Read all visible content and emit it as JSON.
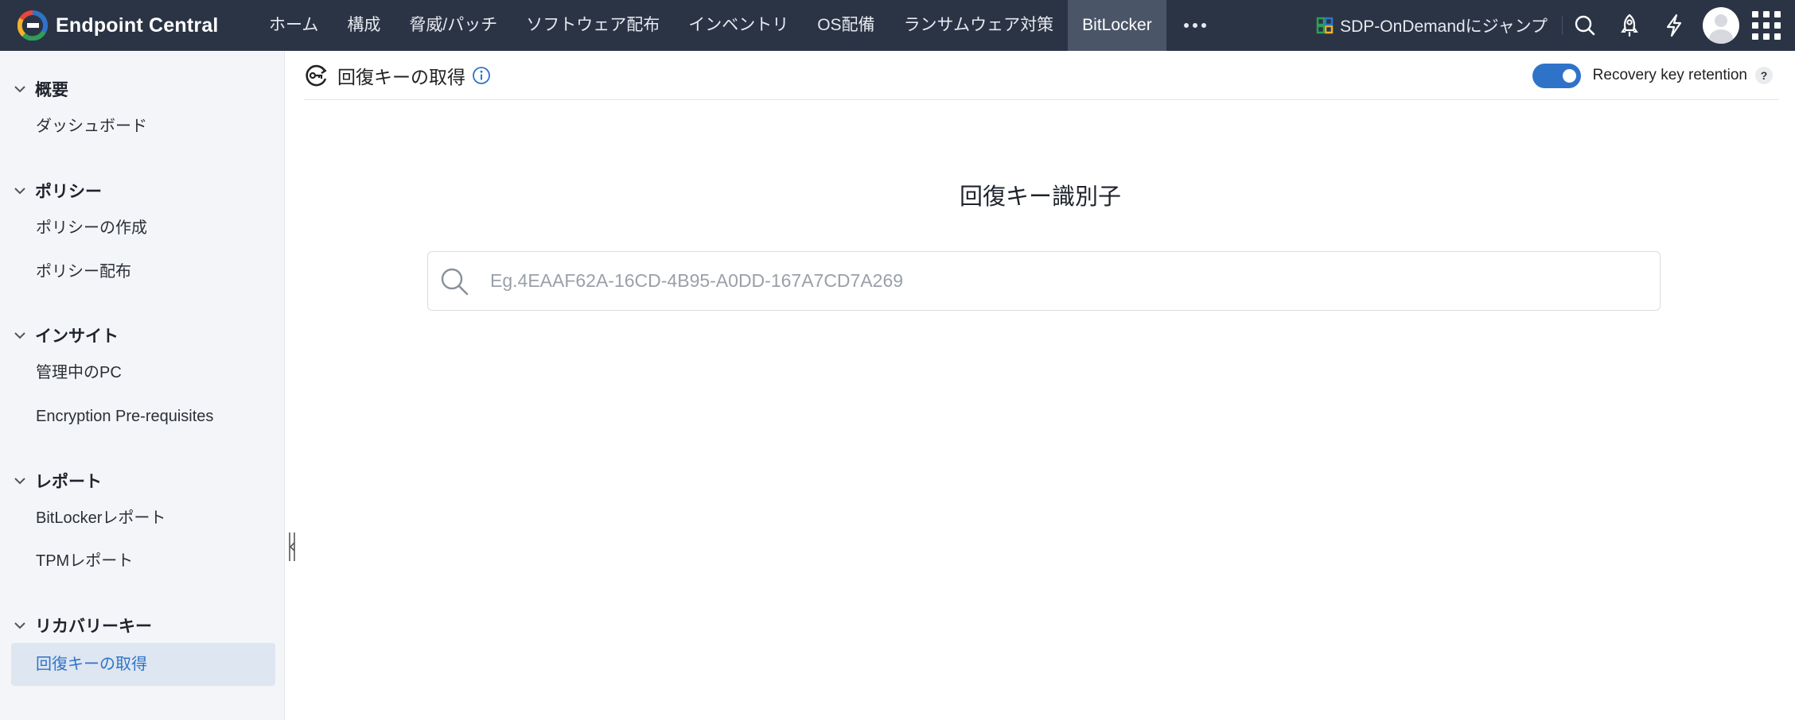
{
  "app": {
    "name": "Endpoint Central"
  },
  "nav": {
    "items": [
      {
        "label": "ホーム"
      },
      {
        "label": "構成"
      },
      {
        "label": "脅威/パッチ"
      },
      {
        "label": "ソフトウェア配布"
      },
      {
        "label": "インベントリ"
      },
      {
        "label": "OS配備"
      },
      {
        "label": "ランサムウェア対策"
      },
      {
        "label": "BitLocker",
        "active": true
      }
    ],
    "more_icon": "more-horizontal-icon"
  },
  "topright": {
    "jump_label": "SDP-OnDemandにジャンプ",
    "icons": [
      "search-icon",
      "rocket-icon",
      "lightning-icon",
      "avatar",
      "apps-grid-icon"
    ]
  },
  "sidebar": {
    "sections": [
      {
        "title": "概要",
        "items": [
          {
            "label": "ダッシュボード"
          }
        ]
      },
      {
        "title": "ポリシー",
        "items": [
          {
            "label": "ポリシーの作成"
          },
          {
            "label": "ポリシー配布"
          }
        ]
      },
      {
        "title": "インサイト",
        "items": [
          {
            "label": "管理中のPC"
          },
          {
            "label": "Encryption Pre-requisites"
          }
        ]
      },
      {
        "title": "レポート",
        "items": [
          {
            "label": "BitLockerレポート"
          },
          {
            "label": "TPMレポート"
          }
        ]
      },
      {
        "title": "リカバリーキー",
        "items": [
          {
            "label": "回復キーの取得",
            "active": true
          }
        ]
      }
    ]
  },
  "page": {
    "title": "回復キーの取得",
    "retention_label": "Recovery key retention",
    "retention_enabled": true,
    "help_label": "?"
  },
  "search": {
    "heading": "回復キー識別子",
    "placeholder": "Eg.4EAAF62A-16CD-4B95-A0DD-167A7CD7A269",
    "value": ""
  },
  "colors": {
    "topbar": "#2b3445",
    "nav_active": "#4a5568",
    "accent": "#2f73c9",
    "sidebar_bg": "#f4f5f8",
    "sidebar_active_bg": "#dde6f1"
  }
}
